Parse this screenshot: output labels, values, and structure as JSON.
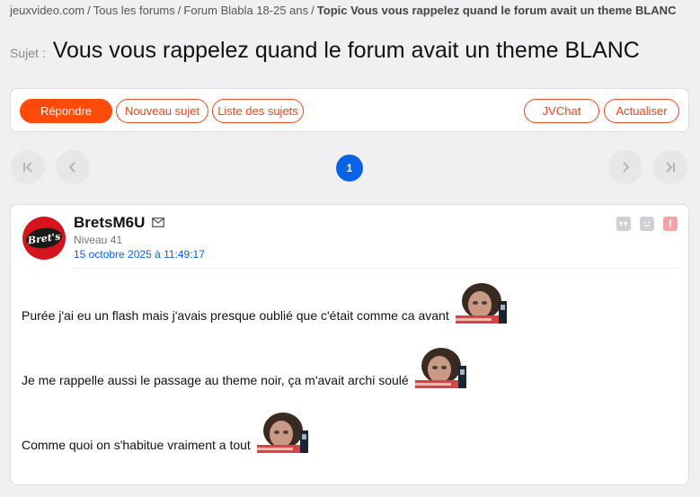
{
  "breadcrumb": {
    "items": [
      "jeuxvideo.com",
      "Tous les forums",
      "Forum Blabla 18-25 ans"
    ],
    "separator": "/",
    "current": "Topic Vous vous rappelez quand le forum avait un theme BLANC"
  },
  "topic": {
    "prefix": "Sujet :",
    "title": "Vous vous rappelez quand le forum avait un theme BLANC"
  },
  "toolbar": {
    "reply": "Répondre",
    "new_topic": "Nouveau sujet",
    "topic_list": "Liste des sujets",
    "jvchat": "JVChat",
    "refresh": "Actualiser",
    "accent_color": "#ff4b0a"
  },
  "pagination": {
    "current_page": "1",
    "icons": [
      "first-page-icon",
      "prev-page-icon",
      "next-page-icon",
      "last-page-icon"
    ],
    "active_color": "#0a63e5"
  },
  "post": {
    "author": "BretsM6U",
    "avatar_text": "Bret's",
    "level": "Niveau 41",
    "date": "15 octobre 2025 à 11:49:17",
    "actions": [
      "quote-icon",
      "face-icon",
      "alert-icon"
    ],
    "lines": [
      "Purée j'ai eu un flash mais j'avais presque oublié que c'était comme ca avant",
      "Je me rappelle aussi le passage au theme noir, ça m'avait archi soulé",
      "Comme quoi on s'habitue vraiment a tout"
    ]
  }
}
